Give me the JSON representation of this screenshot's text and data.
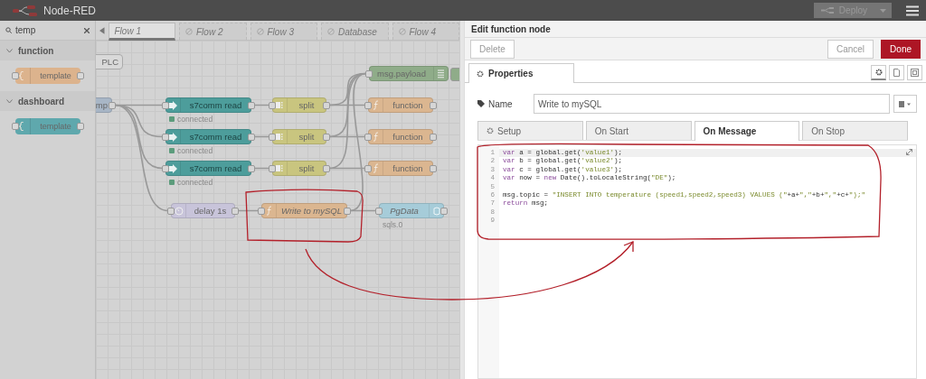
{
  "header": {
    "title": "Node-RED",
    "deploy_label": "Deploy"
  },
  "palette": {
    "search": "temp",
    "categories": [
      {
        "name": "function",
        "expanded": true,
        "nodes": [
          {
            "label": "template",
            "color": "#dcb38d"
          }
        ]
      },
      {
        "name": "dashboard",
        "expanded": true,
        "nodes": [
          {
            "label": "template",
            "color": "#5fa8ad"
          }
        ]
      }
    ]
  },
  "flow_tabs": [
    {
      "label": "Flow 1",
      "selected": true,
      "disabled": false
    },
    {
      "label": "Flow 2",
      "selected": false,
      "disabled": true
    },
    {
      "label": "Flow 3",
      "selected": false,
      "disabled": true
    },
    {
      "label": "Database",
      "selected": false,
      "disabled": true
    },
    {
      "label": "Flow 4",
      "selected": false,
      "disabled": true
    }
  ],
  "nodes": [
    {
      "label": "PLC",
      "kind": "comment",
      "italic": false
    },
    {
      "label": "msg.payload",
      "kind": "debug",
      "color": "#8fac89",
      "italic": false
    },
    {
      "label": "mp",
      "kind": "inject",
      "color": "#a8b6c6",
      "italic": false
    },
    {
      "label": "s7comm read",
      "kind": "s7",
      "color": "#4d9d9b",
      "italic": false,
      "status": {
        "text": "connected",
        "color": "#5c9c7c"
      }
    },
    {
      "label": "split",
      "kind": "split",
      "color": "#c9c57f",
      "italic": false
    },
    {
      "label": "function",
      "kind": "function",
      "color": "#dbb690",
      "italic": false
    },
    {
      "label": "s7comm read",
      "kind": "s7",
      "color": "#4d9d9b",
      "italic": false,
      "status": {
        "text": "connected",
        "color": "#5c9c7c"
      }
    },
    {
      "label": "split",
      "kind": "split",
      "color": "#c9c57f",
      "italic": false
    },
    {
      "label": "function",
      "kind": "function",
      "color": "#dbb690",
      "italic": false
    },
    {
      "label": "s7comm read",
      "kind": "s7",
      "color": "#4d9d9b",
      "italic": false,
      "status": {
        "text": "connected",
        "color": "#5c9c7c"
      }
    },
    {
      "label": "split",
      "kind": "split",
      "color": "#c9c57f",
      "italic": false
    },
    {
      "label": "function",
      "kind": "function",
      "color": "#dbb690",
      "italic": false
    },
    {
      "label": "delay 1s",
      "kind": "delay",
      "color": "#c8c4da",
      "italic": false
    },
    {
      "label": "Write to mySQL",
      "kind": "function",
      "color": "#dbb690",
      "italic": true
    },
    {
      "label": "PgData",
      "kind": "sql",
      "color": "#a6ccd9",
      "italic": true,
      "status": {
        "text": "sqls.0"
      }
    }
  ],
  "editor": {
    "title": "Edit function node",
    "buttons": [
      {
        "label": "Delete",
        "kind": "plain"
      },
      {
        "label": "Cancel",
        "kind": "plain"
      },
      {
        "label": "Done",
        "kind": "primary"
      }
    ],
    "tabs": [
      {
        "label": "Properties",
        "selected": true
      }
    ],
    "name_label": "Name",
    "name_value": "Write to mySQL",
    "subtabs": [
      {
        "label": "Setup",
        "selected": false,
        "icon": true
      },
      {
        "label": "On Start",
        "selected": false,
        "icon": false
      },
      {
        "label": "On Message",
        "selected": true,
        "icon": false
      },
      {
        "label": "On Stop",
        "selected": false,
        "icon": false
      }
    ],
    "code": [
      {
        "number": "1",
        "text": "var a = global.get('value1');"
      },
      {
        "number": "2",
        "text": "var b = global.get('value2');"
      },
      {
        "number": "3",
        "text": "var c = global.get('value3');"
      },
      {
        "number": "4",
        "text": "var now = new Date().toLocaleString(\"DE\");"
      },
      {
        "number": "5"
      },
      {
        "number": "6",
        "text": "msg.topic = \"INSERT INTO temperature (speed1,speed2,speed3) VALUES (\"+a+\",\"+b+\",\"+c+\");\""
      },
      {
        "number": "7",
        "text": "return msg;"
      },
      {
        "number": "8"
      },
      {
        "number": "9"
      }
    ]
  }
}
